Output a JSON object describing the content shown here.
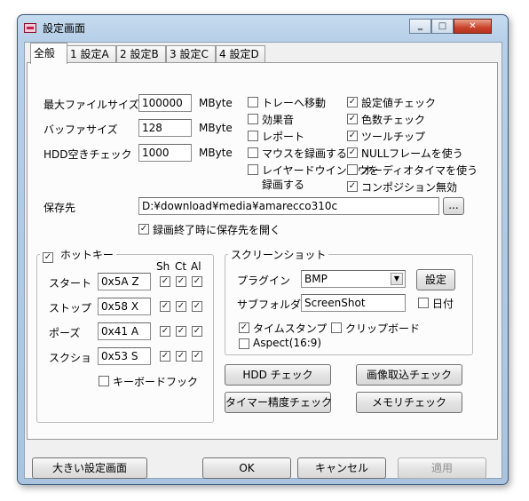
{
  "window": {
    "title": "設定画面"
  },
  "tabs": [
    "全般",
    "1 設定A",
    "2 設定B",
    "3 設定C",
    "4 設定D"
  ],
  "general": {
    "max_file_size": {
      "label": "最大ファイルサイズ",
      "value": "100000",
      "unit": "MByte"
    },
    "buffer_size": {
      "label": "バッファサイズ",
      "value": "128",
      "unit": "MByte"
    },
    "hdd_check": {
      "label": "HDD空きチェック",
      "value": "1000",
      "unit": "MByte"
    }
  },
  "options_mid": [
    {
      "label": "トレーへ移動",
      "checked": false
    },
    {
      "label": "効果音",
      "checked": false
    },
    {
      "label": "レポート",
      "checked": false
    },
    {
      "label": "マウスを録画する",
      "checked": false
    },
    {
      "label": "レイヤードウインドウを",
      "label2": "録画する",
      "checked": false
    }
  ],
  "options_right": [
    {
      "label": "設定値チェック",
      "checked": true
    },
    {
      "label": "色数チェック",
      "checked": true
    },
    {
      "label": "ツールチップ",
      "checked": true
    },
    {
      "label": "NULLフレームを使う",
      "checked": true
    },
    {
      "label": "オーディオタイマを使う",
      "checked": false
    },
    {
      "label": "コンポジション無効",
      "checked": true
    }
  ],
  "save": {
    "label": "保存先",
    "path": "D:¥download¥media¥amarecco310c",
    "browse_label": "...",
    "open_on_end": {
      "label": "録画終了時に保存先を開く",
      "checked": true
    }
  },
  "hotkey": {
    "title": "ホットキー",
    "checked": true,
    "headers": [
      "Sh",
      "Ct",
      "Al"
    ],
    "rows": [
      {
        "label": "スタート",
        "key": "0x5A Z",
        "sh": true,
        "ct": true,
        "al": true
      },
      {
        "label": "ストップ",
        "key": "0x58 X",
        "sh": true,
        "ct": true,
        "al": true
      },
      {
        "label": "ポーズ",
        "key": "0x41 A",
        "sh": true,
        "ct": true,
        "al": true
      },
      {
        "label": "スクショ",
        "key": "0x53 S",
        "sh": true,
        "ct": true,
        "al": true
      }
    ],
    "keyboard_hook": {
      "label": "キーボードフック",
      "checked": false
    }
  },
  "screenshot": {
    "title": "スクリーンショット",
    "plugin_label": "プラグイン",
    "plugin_value": "BMP",
    "settings_label": "設定",
    "subfolder_label": "サブフォルダ",
    "subfolder_value": "ScreenShot",
    "date_label": "日付",
    "date_checked": false,
    "timestamp_label": "タイムスタンプ",
    "timestamp_checked": true,
    "clipboard_label": "クリップボード",
    "clipboard_checked": false,
    "aspect_label": "Aspect(16:9)",
    "aspect_checked": false
  },
  "check_buttons": {
    "hdd": "HDD チェック",
    "image_capture": "画像取込チェック",
    "timer": "タイマー精度チェック",
    "memory": "メモリチェック"
  },
  "bottom_buttons": {
    "large_settings": "大きい設定画面",
    "ok": "OK",
    "cancel": "キャンセル",
    "apply": "適用"
  }
}
